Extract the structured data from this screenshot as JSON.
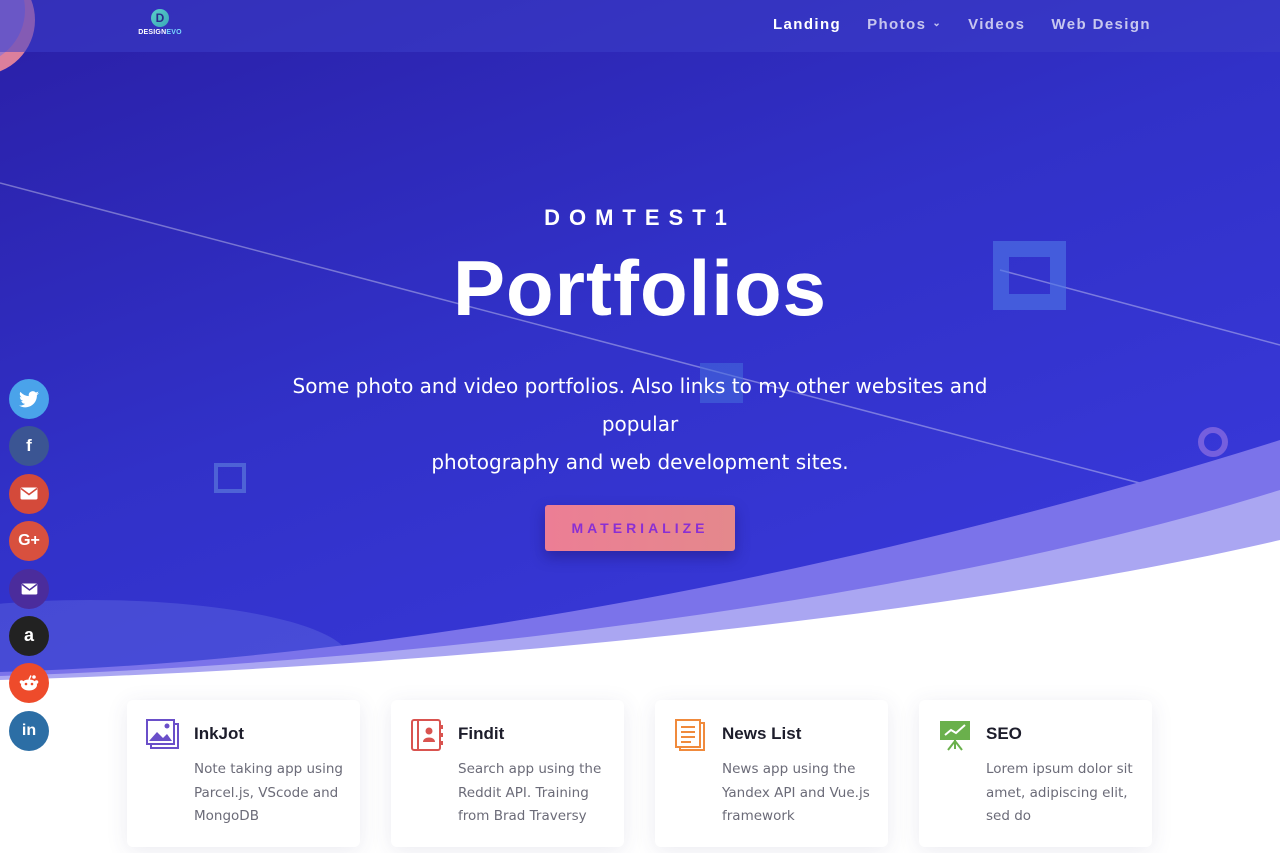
{
  "nav": {
    "logo_letter": "D",
    "logo_text_a": "DESIGN",
    "logo_text_b": "EVO",
    "items": [
      {
        "label": "Landing",
        "active": true
      },
      {
        "label": "Photos",
        "has_dropdown": true
      },
      {
        "label": "Videos"
      },
      {
        "label": "Web Design"
      }
    ]
  },
  "hero": {
    "eyebrow": "DOMTEST1",
    "title": "Portfolios",
    "subtitle_line1": "Some photo and video portfolios. Also links to my other websites and popular",
    "subtitle_line2": "photography and web development sites.",
    "cta_label": "MATERIALIZE"
  },
  "share": [
    {
      "icon": "twitter-icon",
      "glyph": "t",
      "color": "#4aa3ea"
    },
    {
      "icon": "facebook-icon",
      "glyph": "f",
      "color": "#3b5593"
    },
    {
      "icon": "gmail-icon",
      "glyph": "✉",
      "color": "#d44a3a"
    },
    {
      "icon": "google-plus-icon",
      "glyph": "G+",
      "color": "#d8503e"
    },
    {
      "icon": "email-icon",
      "glyph": "✉",
      "color": "#4b2c9c"
    },
    {
      "icon": "amazon-icon",
      "glyph": "a",
      "color": "#222222"
    },
    {
      "icon": "reddit-icon",
      "glyph": "r",
      "color": "#ee4b2b"
    },
    {
      "icon": "linkedin-icon",
      "glyph": "in",
      "color": "#2c6ea5"
    }
  ],
  "cards": [
    {
      "title": "InkJot",
      "text": "Note taking app using Parcel.js, VScode and MongoDB",
      "icon": "image-gallery-icon",
      "color": "#6a4fc9"
    },
    {
      "title": "Findit",
      "text": "Search app using the Reddit API. Training from Brad Traversy",
      "icon": "address-book-icon",
      "color": "#d9534f"
    },
    {
      "title": "News List",
      "text": "News app using the Yandex API and Vue.js framework",
      "icon": "document-list-icon",
      "color": "#f08a3c"
    },
    {
      "title": "SEO",
      "text": "Lorem ipsum dolor sit amet,  adipiscing elit, sed do",
      "icon": "chart-board-icon",
      "color": "#6ab04c"
    }
  ]
}
